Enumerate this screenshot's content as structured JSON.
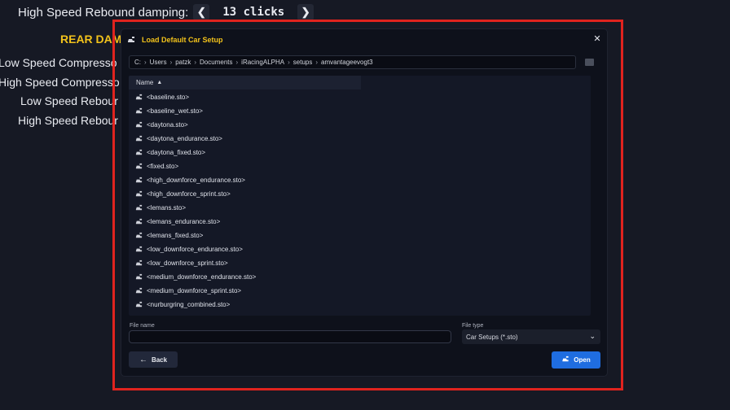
{
  "background": {
    "top_label": "High Speed Rebound damping:",
    "top_value": "13 clicks",
    "section_title": "REAR DAMP",
    "rows": [
      "Low Speed Compresso",
      "High Speed Compresso",
      "Low Speed Rebour",
      "High Speed Rebour"
    ]
  },
  "dialog": {
    "title": "Load Default Car Setup",
    "path": [
      "C:",
      "Users",
      "patzk",
      "Documents",
      "iRacingALPHA",
      "setups",
      "amvantageevogt3"
    ],
    "column_name": "Name",
    "files": [
      "<baseline.sto>",
      "<baseline_wet.sto>",
      "<daytona.sto>",
      "<daytona_endurance.sto>",
      "<daytona_fixed.sto>",
      "<fixed.sto>",
      "<high_downforce_endurance.sto>",
      "<high_downforce_sprint.sto>",
      "<lemans.sto>",
      "<lemans_endurance.sto>",
      "<lemans_fixed.sto>",
      "<low_downforce_endurance.sto>",
      "<low_downforce_sprint.sto>",
      "<medium_downforce_endurance.sto>",
      "<medium_downforce_sprint.sto>",
      "<nurburgring_combined.sto>"
    ],
    "file_name_label": "File name",
    "file_name_value": "",
    "file_type_label": "File type",
    "file_type_value": "Car Setups (*.sto)",
    "back_label": "Back",
    "open_label": "Open"
  },
  "colors": {
    "accent_yellow": "#f2c21b",
    "open_blue": "#1f6de0",
    "highlight_red": "#e0231e"
  }
}
